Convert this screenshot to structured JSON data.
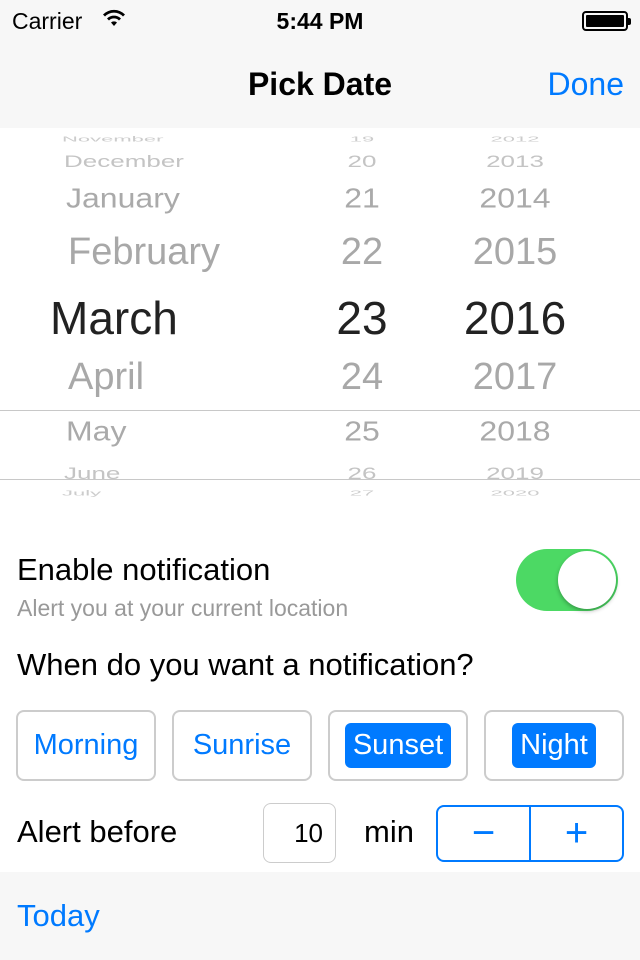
{
  "status_bar": {
    "carrier": "Carrier",
    "time": "5:44 PM",
    "wifi_icon": "wifi-icon",
    "battery_level": 1.0
  },
  "nav": {
    "title": "Pick Date",
    "done_label": "Done"
  },
  "picker": {
    "months": [
      "November",
      "December",
      "January",
      "February",
      "March",
      "April",
      "May",
      "June",
      "July"
    ],
    "days": [
      "19",
      "20",
      "21",
      "22",
      "23",
      "24",
      "25",
      "26",
      "27"
    ],
    "years": [
      "2012",
      "2013",
      "2014",
      "2015",
      "2016",
      "2017",
      "2018",
      "2019",
      "2020"
    ],
    "selected": {
      "month": "March",
      "day": "23",
      "year": "2016"
    }
  },
  "notification": {
    "label": "Enable notification",
    "sublabel": "Alert you at your current location",
    "enabled": true
  },
  "question": "When do you want a notification?",
  "times": [
    {
      "label": "Morning",
      "selected": false
    },
    {
      "label": "Sunrise",
      "selected": false
    },
    {
      "label": "Sunset",
      "selected": true
    },
    {
      "label": "Night",
      "selected": true
    }
  ],
  "alert": {
    "label": "Alert before",
    "value": "10",
    "unit": "min",
    "minus": "−",
    "plus": "+"
  },
  "toolbar": {
    "today_label": "Today"
  },
  "colors": {
    "accent": "#007aff",
    "switch_on": "#4cd964"
  }
}
